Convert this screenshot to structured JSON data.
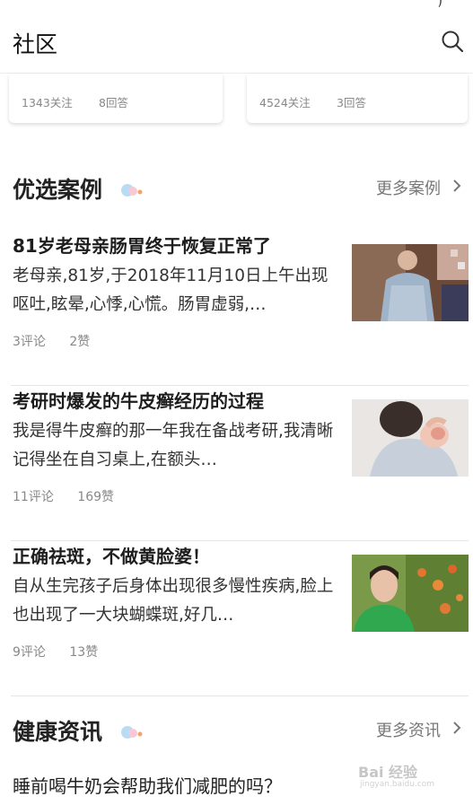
{
  "header": {
    "title": "社区",
    "status_glyph": ")"
  },
  "topic_cards": [
    {
      "follows": "1343关注",
      "answers": "8回答"
    },
    {
      "follows": "4524关注",
      "answers": "3回答"
    }
  ],
  "cases_section": {
    "title": "优选案例",
    "more": "更多案例"
  },
  "cases": [
    {
      "title": "81岁老母亲肠胃终于恢复正常了",
      "desc": "老母亲,81岁,于2018年11月10日上午出现呕吐,眩晕,心悸,心慌。肠胃虚弱,…",
      "comments": "3评论",
      "likes": "2赞"
    },
    {
      "title": "考研时爆发的牛皮癣经历的过程",
      "desc": "我是得牛皮癣的那一年我在备战考研,我清晰记得坐在自习桌上,在额头…",
      "comments": "11评论",
      "likes": "169赞"
    },
    {
      "title": "正确祛斑，不做黄脸婆！",
      "desc": "自从生完孩子后身体出现很多慢性疾病,脸上也出现了一大块蝴蝶斑,好几…",
      "comments": "9评论",
      "likes": "13赞"
    }
  ],
  "news_section": {
    "title": "健康资讯",
    "more": "更多资讯"
  },
  "news": [
    {
      "title": "睡前喝牛奶会帮助我们减肥的吗？"
    }
  ],
  "watermark": {
    "text": "Bai 经验",
    "url": "jingyan.baidu.com"
  },
  "colors": {
    "dot_blue": "#b9dcf5",
    "dot_pink": "#f7c9d6",
    "dot_orange": "#f2a36b"
  }
}
